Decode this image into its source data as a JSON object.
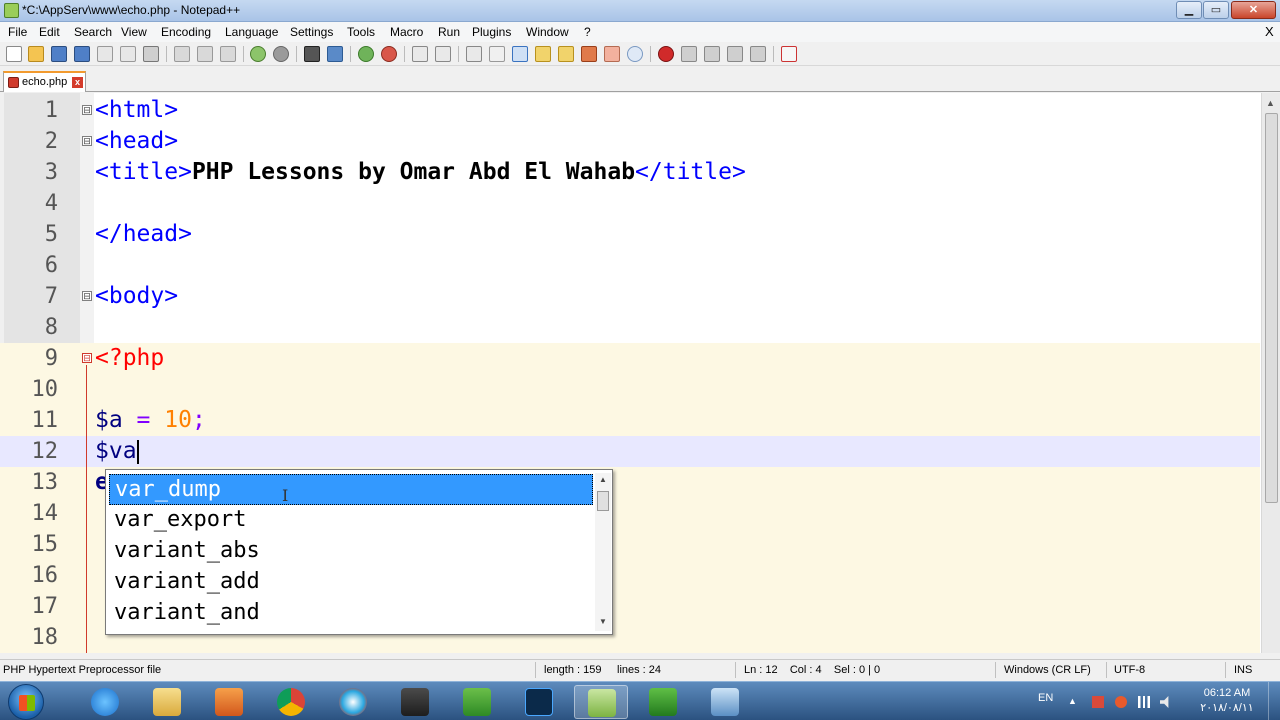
{
  "window": {
    "title": "*C:\\AppServ\\www\\echo.php - Notepad++",
    "minimize_label": "▁",
    "maximize_label": "▭",
    "close_label": "✕"
  },
  "menu": {
    "items": [
      "File",
      "Edit",
      "Search",
      "View",
      "Encoding",
      "Language",
      "Settings",
      "Tools",
      "Macro",
      "Run",
      "Plugins",
      "Window",
      "?"
    ],
    "close_doc": "X"
  },
  "tabs": [
    {
      "label": "echo.php",
      "close_label": "x"
    }
  ],
  "editor": {
    "line_numbers": [
      "1",
      "2",
      "3",
      "4",
      "5",
      "6",
      "7",
      "8",
      "9",
      "10",
      "11",
      "12",
      "13",
      "14",
      "15",
      "16",
      "17",
      "18"
    ],
    "lines": {
      "l1": "<html>",
      "l2": "<head>",
      "l3_open": "<title>",
      "l3_text": "PHP Lessons by Omar Abd El Wahab",
      "l3_close": "</title>",
      "l5": "</head>",
      "l7": "<body>",
      "l9": "<?php",
      "l11_var": "$a",
      "l11_op": " = ",
      "l11_num": "10",
      "l11_end": ";",
      "l12": "$va",
      "l13_partial": "e"
    },
    "fold_marker": "⊟"
  },
  "autocomplete": {
    "items": [
      "var_dump",
      "var_export",
      "variant_abs",
      "variant_add",
      "variant_and"
    ],
    "selected_index": 0
  },
  "statusbar": {
    "file_type": "PHP Hypertext Preprocessor file",
    "length": "length : 159",
    "lines": "lines : 24",
    "position": "Ln : 12    Col : 4    Sel : 0 | 0",
    "eol": "Windows (CR LF)",
    "encoding": "UTF-8",
    "mode": "INS"
  },
  "taskbar": {
    "apps": [
      "internet-explorer",
      "file-explorer",
      "media-player",
      "chrome",
      "skype",
      "media-player-classic",
      "camtasia",
      "photoshop",
      "notepad-plus-plus",
      "camtasia-recorder",
      "remote-desktop"
    ],
    "language": "EN",
    "time": "06:12 AM",
    "date": "٢٠١٨/٠٨/١١"
  },
  "colors": {
    "html_tag": "#0000ff",
    "php_tag": "#ff0000",
    "php_var": "#000080",
    "php_number": "#ff8000",
    "php_operator": "#8000ff",
    "selection": "#3399ff",
    "current_line": "#e8e8ff"
  }
}
